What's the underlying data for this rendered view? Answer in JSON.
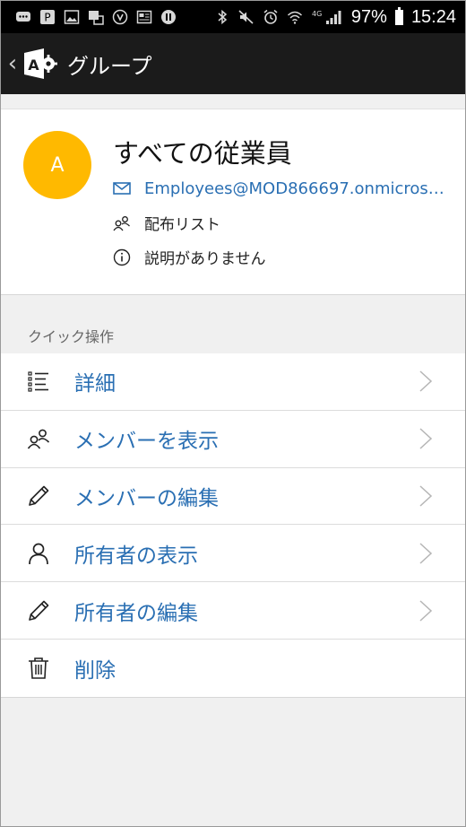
{
  "status_bar": {
    "battery": "97%",
    "time": "15:24",
    "network": "4G"
  },
  "app_bar": {
    "title": "グループ"
  },
  "group": {
    "avatar_letter": "A",
    "avatar_color": "#ffb900",
    "name": "すべての従業員",
    "email": "Employees@MOD866697.onmicros…",
    "type": "配布リスト",
    "description": "説明がありません"
  },
  "quick_actions": {
    "label": "クイック操作",
    "items": [
      {
        "label": "詳細",
        "icon": "details-list-icon"
      },
      {
        "label": "メンバーを表示",
        "icon": "people-icon"
      },
      {
        "label": "メンバーの編集",
        "icon": "pencil-icon"
      },
      {
        "label": "所有者の表示",
        "icon": "person-icon"
      },
      {
        "label": "所有者の編集",
        "icon": "pencil-icon"
      },
      {
        "label": "削除",
        "icon": "trash-icon"
      }
    ]
  },
  "colors": {
    "accent": "#2a6fb3",
    "app_bar": "#1b1b1b"
  }
}
